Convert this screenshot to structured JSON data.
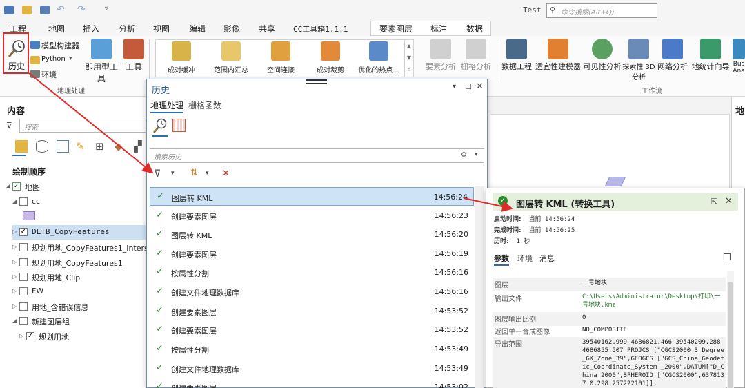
{
  "app": {
    "title": "Test"
  },
  "search": {
    "placeholder": "命令搜索(Alt+Q)"
  },
  "ribbon_tabs": [
    "工程",
    "地图",
    "插入",
    "分析",
    "视图",
    "编辑",
    "影像",
    "共享",
    "CC工具箱1.1.1",
    "要素图层",
    "标注",
    "数据"
  ],
  "geoprocessing": {
    "history": "历史",
    "model_builder": "模型构建器",
    "python": "Python",
    "environments": "环境",
    "group_label": "地理处理"
  },
  "instant_tools": "即用型工具",
  "tools": "工具",
  "gallery_tools": [
    "成对缓冲",
    "范围内汇总",
    "空间连接",
    "成对裁剪",
    "优化的热点..."
  ],
  "analysis_buttons": [
    "要素分析",
    "栅格分析"
  ],
  "workflow_buttons": [
    "数据工程",
    "适宜性建模器",
    "可见性分析",
    "探索性 3D 分析",
    "网络分析",
    "地统计向导",
    "Bus Ana"
  ],
  "workflow_group_label": "工作流",
  "contents": {
    "title": "内容",
    "search_placeholder": "搜索",
    "draw_order": "绘制顺序",
    "layers": [
      {
        "name": "地图",
        "indent": 0,
        "checked": true,
        "expanded": true
      },
      {
        "name": "cc",
        "indent": 1,
        "checked": false,
        "expanded": true
      },
      {
        "name": "DLTB_CopyFeatures",
        "indent": 1,
        "checked": true,
        "expanded": false,
        "selected": true
      },
      {
        "name": "规划用地_CopyFeatures1_Interse",
        "indent": 1,
        "checked": false,
        "expanded": false
      },
      {
        "name": "规划用地_CopyFeatures1",
        "indent": 1,
        "checked": false,
        "expanded": false
      },
      {
        "name": "规划用地_Clip",
        "indent": 1,
        "checked": false,
        "expanded": false
      },
      {
        "name": "FW",
        "indent": 1,
        "checked": false,
        "expanded": false
      },
      {
        "name": "用地_含错误信息",
        "indent": 1,
        "checked": false,
        "expanded": false
      },
      {
        "name": "新建图层组",
        "indent": 1,
        "checked": false,
        "expanded": true
      },
      {
        "name": "规划用地",
        "indent": 2,
        "checked": true,
        "expanded": false
      }
    ]
  },
  "history_window": {
    "title": "历史",
    "tab_geoprocessing": "地理处理",
    "tab_raster": "栅格函数",
    "search_placeholder": "搜索历史",
    "entries": [
      {
        "name": "图层转 KML",
        "time": "14:56:24",
        "selected": true
      },
      {
        "name": "创建要素图层",
        "time": "14:56:23"
      },
      {
        "name": "图层转 KML",
        "time": "14:56:20"
      },
      {
        "name": "创建要素图层",
        "time": "14:56:19"
      },
      {
        "name": "按属性分割",
        "time": "14:56:16"
      },
      {
        "name": "创建文件地理数据库",
        "time": "14:56:16"
      },
      {
        "name": "创建要素图层",
        "time": "14:53:52"
      },
      {
        "name": "创建要素图层",
        "time": "14:53:52"
      },
      {
        "name": "按属性分割",
        "time": "14:53:49"
      },
      {
        "name": "创建文件地理数据库",
        "time": "14:53:49"
      },
      {
        "name": "创建要素图层",
        "time": "14:53:02"
      }
    ]
  },
  "detail": {
    "title": "图层转 KML (转换工具)",
    "start_label": "启动时间:",
    "start_value": "当前 14:56:24",
    "end_label": "完成时间:",
    "end_value": "当前 14:56:25",
    "duration_label": "历时:",
    "duration_value": "1 秒",
    "tabs": [
      "参数",
      "环境",
      "消息"
    ],
    "params": [
      {
        "key": "图层",
        "value": "一号地块"
      },
      {
        "key": "输出文件",
        "value": "C:\\Users\\Administrator\\Desktop\\打印\\一号地块.kmz"
      },
      {
        "key": "图层输出比例",
        "value": "0"
      },
      {
        "key": "返回单一合成图像",
        "value": "NO_COMPOSITE"
      },
      {
        "key": "导出范围",
        "value": "39540162.999 4686821.466 39540209.288 4686855.507 PROJCS [\"CGCS2000_3_Degree_GK_Zone_39\",GEOGCS [\"GCS_China_Geodetic_Coordinate_System _2000\",DATUM[\"D_China_2000\",SPHEROID [\"CGCS2000\",6378137.0,298.257222101]],"
      }
    ]
  },
  "right_panel_label": "地",
  "colors": {
    "accent": "#2a6ebb",
    "success": "#2d8a2d",
    "annotation": "#e02a2a",
    "selection": "#cfe3f6"
  }
}
